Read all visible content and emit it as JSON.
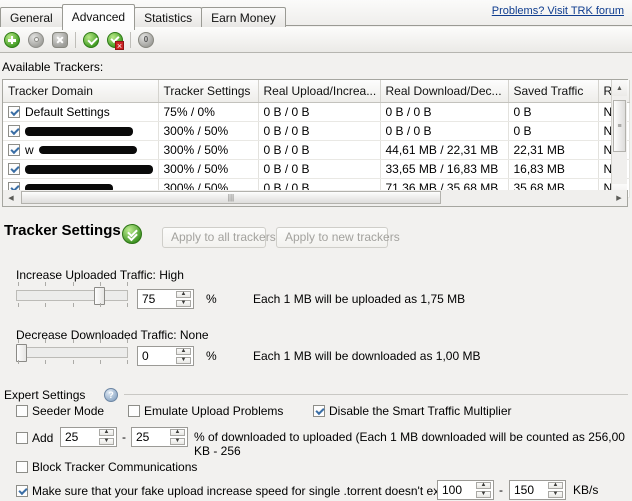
{
  "tabs": [
    {
      "label": "General",
      "active": false
    },
    {
      "label": "Advanced",
      "active": true
    },
    {
      "label": "Statistics",
      "active": false
    },
    {
      "label": "Earn Money",
      "active": false
    }
  ],
  "help_link": "Problems? Visit TRK forum",
  "toolbar": {
    "items": [
      {
        "icon": "add-tracker-icon",
        "name": "add-tracker-button"
      },
      {
        "icon": "gear-icon",
        "name": "edit-tracker-button"
      },
      {
        "icon": "delete-icon",
        "name": "delete-tracker-button"
      },
      {
        "icon": "enable-icon",
        "name": "enable-tracker-button"
      },
      {
        "icon": "disable-icon",
        "name": "disable-tracker-button"
      },
      {
        "icon": "zero-icon",
        "name": "reset-counter-button"
      }
    ]
  },
  "trackers": {
    "label": "Available Trackers:",
    "columns": [
      "Tracker Domain",
      "Tracker Settings",
      "Real Upload/Increa...",
      "Real Download/Dec...",
      "Saved Traffic",
      "Re"
    ],
    "rows": [
      {
        "checked": true,
        "domain": "Default Settings",
        "redacted": false,
        "redact_width": 0,
        "settings": "75% / 0%",
        "real_upload": "0 B / 0 B",
        "real_download": "0 B / 0 B",
        "saved": "0 B",
        "re": "No"
      },
      {
        "checked": true,
        "domain": "",
        "redacted": true,
        "redact_width": 108,
        "prefix": "",
        "settings": "300% / 50%",
        "real_upload": "0 B / 0 B",
        "real_download": "0 B / 0 B",
        "saved": "0 B",
        "re": "No"
      },
      {
        "checked": true,
        "domain": "",
        "redacted": true,
        "redact_width": 98,
        "prefix": "w",
        "settings": "300% / 50%",
        "real_upload": "0 B / 0 B",
        "real_download": "44,61 MB / 22,31 MB",
        "saved": "22,31 MB",
        "re": "No"
      },
      {
        "checked": true,
        "domain": "",
        "redacted": true,
        "redact_width": 130,
        "prefix": "",
        "settings": "300% / 50%",
        "real_upload": "0 B / 0 B",
        "real_download": "33,65 MB / 16,83 MB",
        "saved": "16,83 MB",
        "re": "No"
      },
      {
        "checked": true,
        "domain": "",
        "redacted": true,
        "redact_width": 88,
        "prefix": "",
        "settings": "300% / 50%",
        "real_upload": "0 B / 0 B",
        "real_download": "71,36 MB / 35,68 MB",
        "saved": "35,68 MB",
        "re": "No"
      }
    ]
  },
  "tracker_settings": {
    "heading": "Tracker Settings",
    "chevron_icon": "chevron-down-icon",
    "apply_all_label": "Apply to all trackers",
    "apply_new_label": "Apply to new trackers",
    "increase": {
      "label": "Increase Uploaded Traffic: High",
      "value": "75",
      "unit": "%",
      "percent": 75,
      "description": "Each 1 MB will be uploaded as 1,75 MB"
    },
    "decrease": {
      "label": "Decrease Downloaded Traffic: None",
      "value": "0",
      "unit": "%",
      "percent": 0,
      "description": "Each 1 MB will be downloaded as 1,00 MB"
    }
  },
  "expert": {
    "label": "Expert Settings",
    "help_icon": "help-icon",
    "seeder_mode": {
      "label": "Seeder Mode",
      "checked": false
    },
    "emulate_upload": {
      "label": "Emulate Upload Problems",
      "checked": false
    },
    "disable_multiplier": {
      "label": "Disable the Smart Traffic Multiplier",
      "checked": true
    },
    "add_row": {
      "label": "Add",
      "checked": false,
      "value_min": "25",
      "separator": "-",
      "value_max": "25",
      "description": "% of downloaded to uploaded (Each 1 MB downloaded will be counted as 256,00 KB - 256"
    },
    "block_tracker": {
      "label": "Block Tracker Communications",
      "checked": false
    },
    "speed_limit": {
      "label": "Make sure that your fake upload increase speed for single .torrent doesn't exceed",
      "checked": true,
      "value_min": "100",
      "separator": "-",
      "value_max": "150",
      "unit": "KB/s"
    }
  }
}
